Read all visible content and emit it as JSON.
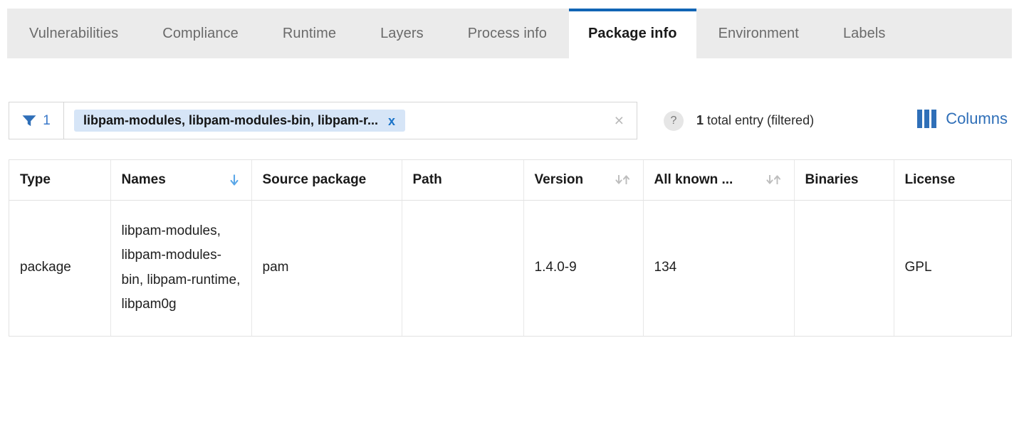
{
  "colors": {
    "accent_blue": "#1165b5",
    "link_blue": "#2f6fb8",
    "sort_active_blue": "#4f9fe0",
    "chip_bg": "#d6e5f7",
    "tabbar_bg": "#ebebeb"
  },
  "tabs": [
    {
      "label": "Vulnerabilities",
      "active": false
    },
    {
      "label": "Compliance",
      "active": false
    },
    {
      "label": "Runtime",
      "active": false
    },
    {
      "label": "Layers",
      "active": false
    },
    {
      "label": "Process info",
      "active": false
    },
    {
      "label": "Package info",
      "active": true
    },
    {
      "label": "Environment",
      "active": false
    },
    {
      "label": "Labels",
      "active": false
    }
  ],
  "toolbar": {
    "filter_icon": "funnel-icon",
    "filter_count": "1",
    "chip_label": "libpam-modules, libpam-modules-bin, libpam-r...",
    "chip_remove": "x",
    "clear_search": "×",
    "search_placeholder": "",
    "help_icon": "?",
    "entry_count_number": "1",
    "entry_count_text": " total entry (filtered)",
    "columns_icon": "columns-icon",
    "columns_label": "Columns"
  },
  "table": {
    "columns": [
      {
        "label": "Type",
        "sort": "none"
      },
      {
        "label": "Names",
        "sort": "desc-active"
      },
      {
        "label": "Source package",
        "sort": "none"
      },
      {
        "label": "Path",
        "sort": "none"
      },
      {
        "label": "Version",
        "sort": "both"
      },
      {
        "label": "All known ...",
        "sort": "both"
      },
      {
        "label": "Binaries",
        "sort": "none"
      },
      {
        "label": "License",
        "sort": "none"
      }
    ],
    "rows": [
      {
        "type": "package",
        "names": "libpam-modules, libpam-modules-bin, libpam-runtime, libpam0g",
        "source_package": "pam",
        "path": "",
        "version": "1.4.0-9",
        "all_known": "134",
        "binaries": "",
        "license": "GPL"
      }
    ]
  }
}
